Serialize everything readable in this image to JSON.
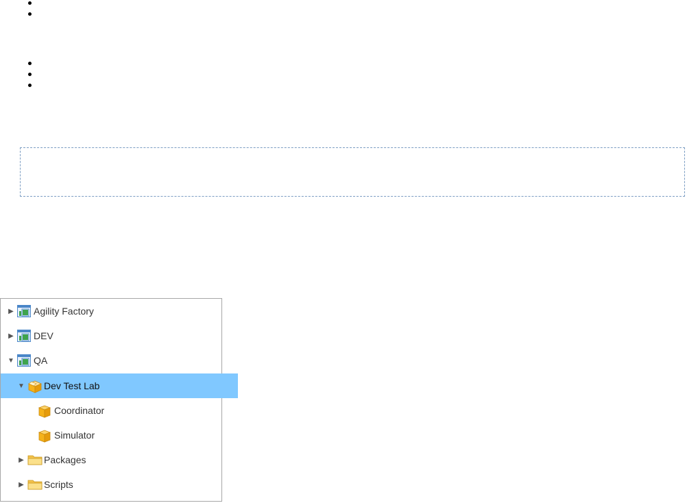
{
  "tree": {
    "items": [
      {
        "label": "Agility Factory",
        "icon": "app-window-icon",
        "toggle": "▶",
        "selected": false
      },
      {
        "label": "DEV",
        "icon": "app-window-icon",
        "toggle": "▶",
        "selected": false
      },
      {
        "label": "QA",
        "icon": "app-window-icon",
        "toggle": "▼",
        "selected": false
      },
      {
        "label": "Dev Test Lab",
        "icon": "box-open-icon",
        "toggle": "▼",
        "selected": true
      },
      {
        "label": "Coordinator",
        "icon": "box-icon",
        "toggle": "",
        "selected": false
      },
      {
        "label": "Simulator",
        "icon": "box-icon",
        "toggle": "",
        "selected": false
      },
      {
        "label": "Packages",
        "icon": "folder-icon",
        "toggle": "▶",
        "selected": false
      },
      {
        "label": "Scripts",
        "icon": "folder-icon",
        "toggle": "▶",
        "selected": false
      }
    ]
  },
  "colors": {
    "selection": "#80c8ff",
    "box_orange": "#f5b21a",
    "folder_yellow": "#f7d46a",
    "app_blue": "#4a86c8",
    "app_green": "#3fa34d"
  }
}
